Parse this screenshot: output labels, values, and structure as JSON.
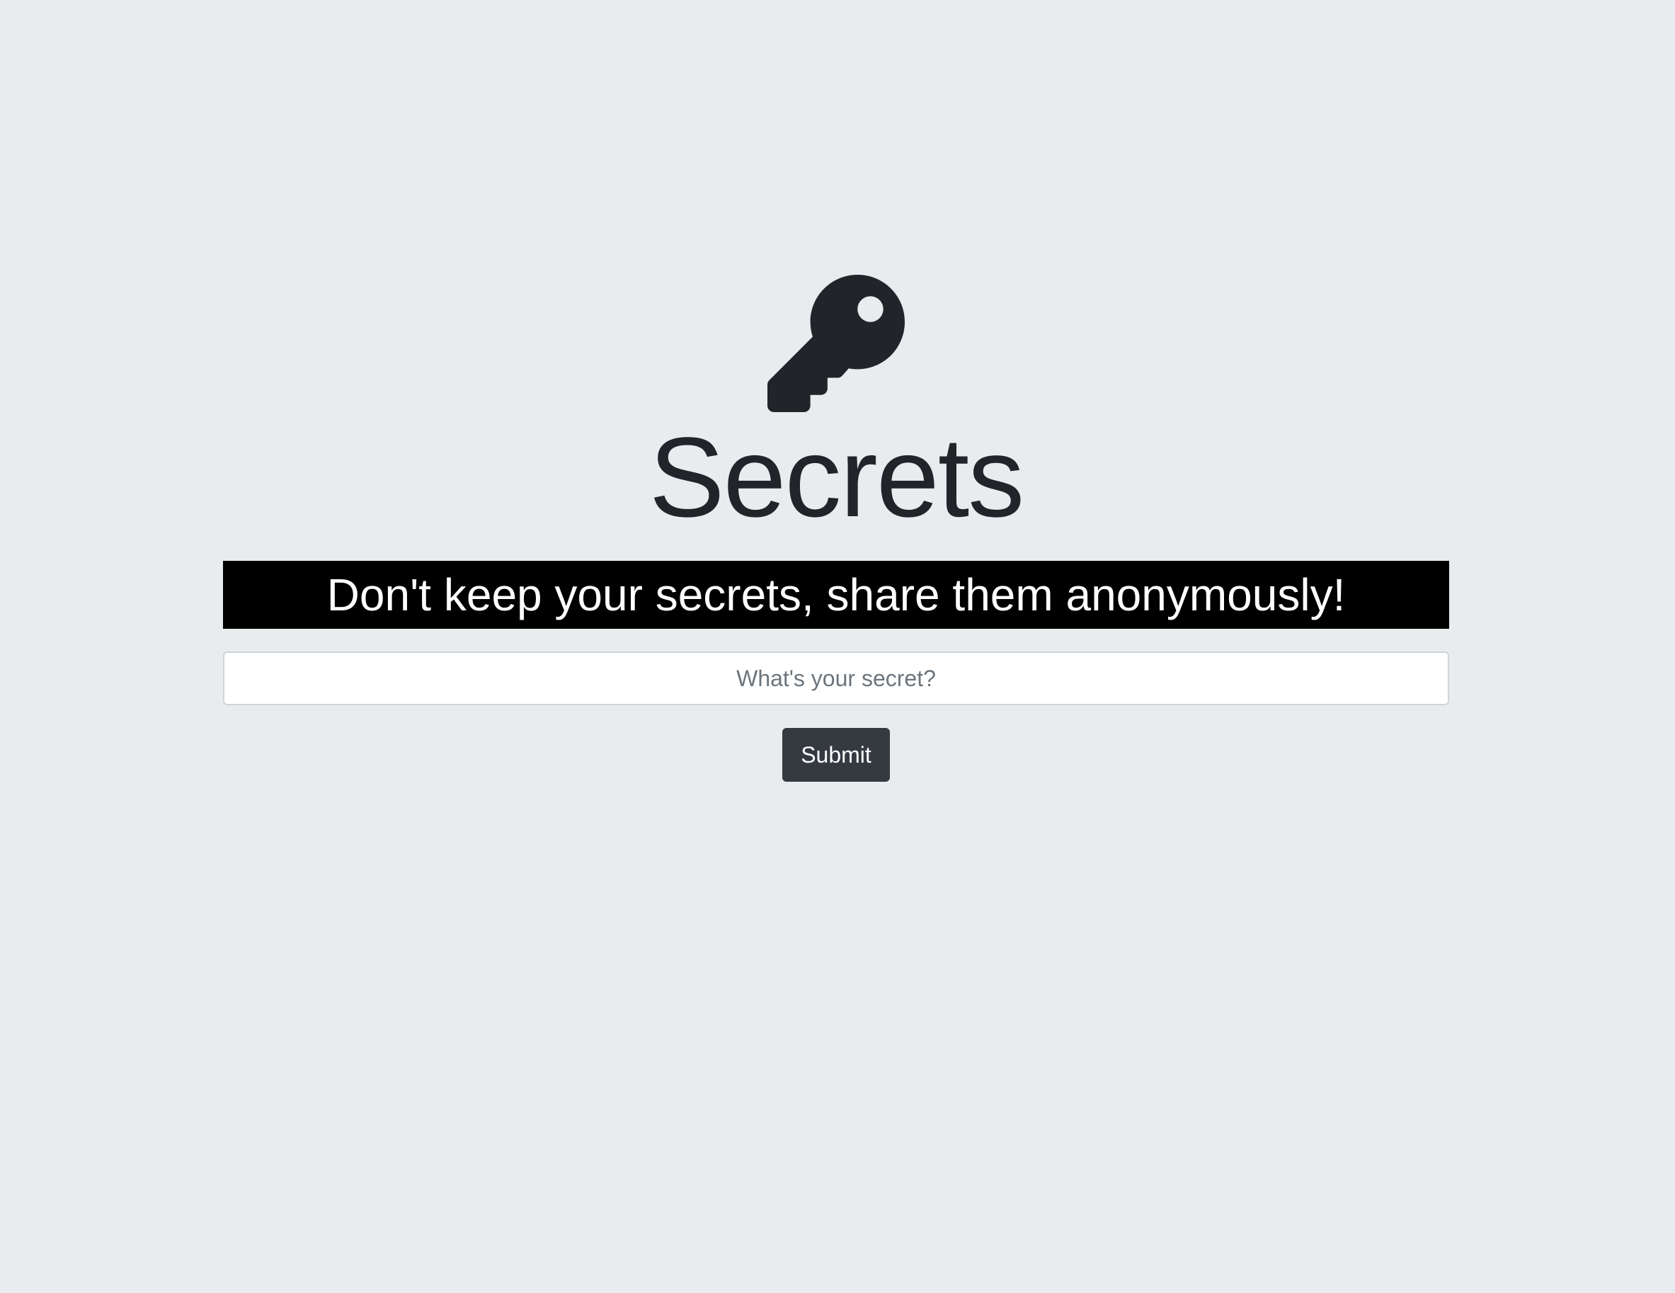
{
  "hero": {
    "icon": "key-icon",
    "title": "Secrets",
    "tagline": "Don't keep your secrets, share them anonymously!"
  },
  "form": {
    "secret_placeholder": "What's your secret?",
    "secret_value": "",
    "submit_label": "Submit"
  },
  "colors": {
    "background": "#e9ecef",
    "banner_background": "#000000",
    "banner_text": "#ffffff",
    "button_background": "#343a40",
    "text": "#212529"
  }
}
